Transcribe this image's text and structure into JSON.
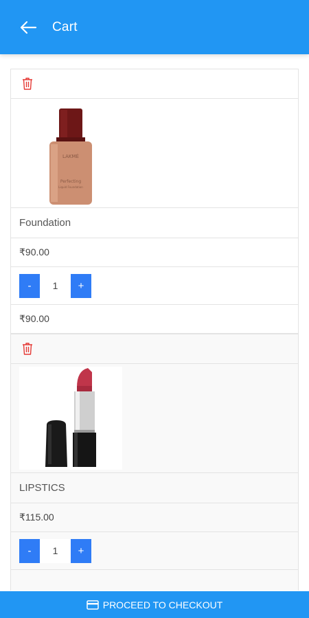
{
  "header": {
    "title": "Cart",
    "back_icon": "arrow-left-icon"
  },
  "colors": {
    "primary": "#2196f3",
    "qty_button": "#2f7cf6",
    "delete_icon": "#e53935"
  },
  "cart": {
    "items": [
      {
        "name": "Foundation",
        "price": "₹90.00",
        "quantity": "1",
        "subtotal": "₹90.00",
        "minus_label": "-",
        "plus_label": "+",
        "image": "foundation-bottle"
      },
      {
        "name": "LIPSTICS",
        "price": "₹115.00",
        "quantity": "1",
        "minus_label": "-",
        "plus_label": "+",
        "image": "lipstick"
      }
    ]
  },
  "footer": {
    "checkout_label": "PROCEED TO CHECKOUT",
    "icon": "credit-card-icon"
  }
}
